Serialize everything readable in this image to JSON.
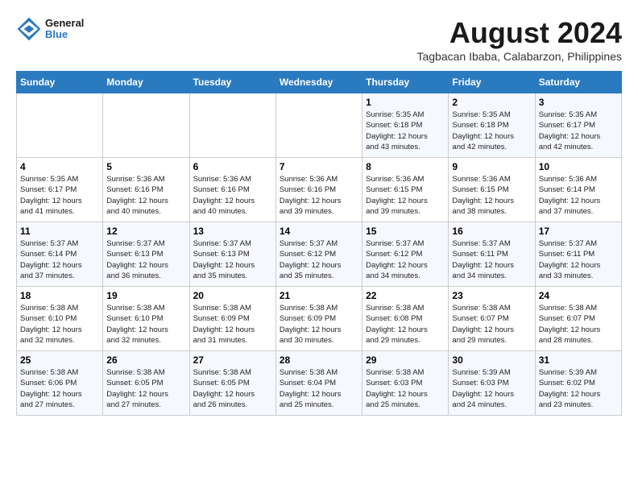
{
  "logo": {
    "line1": "General",
    "line2": "Blue"
  },
  "title": "August 2024",
  "subtitle": "Tagbacan Ibaba, Calabarzon, Philippines",
  "days_of_week": [
    "Sunday",
    "Monday",
    "Tuesday",
    "Wednesday",
    "Thursday",
    "Friday",
    "Saturday"
  ],
  "weeks": [
    [
      {
        "day": "",
        "info": ""
      },
      {
        "day": "",
        "info": ""
      },
      {
        "day": "",
        "info": ""
      },
      {
        "day": "",
        "info": ""
      },
      {
        "day": "1",
        "info": "Sunrise: 5:35 AM\nSunset: 6:18 PM\nDaylight: 12 hours\nand 43 minutes."
      },
      {
        "day": "2",
        "info": "Sunrise: 5:35 AM\nSunset: 6:18 PM\nDaylight: 12 hours\nand 42 minutes."
      },
      {
        "day": "3",
        "info": "Sunrise: 5:35 AM\nSunset: 6:17 PM\nDaylight: 12 hours\nand 42 minutes."
      }
    ],
    [
      {
        "day": "4",
        "info": "Sunrise: 5:35 AM\nSunset: 6:17 PM\nDaylight: 12 hours\nand 41 minutes."
      },
      {
        "day": "5",
        "info": "Sunrise: 5:36 AM\nSunset: 6:16 PM\nDaylight: 12 hours\nand 40 minutes."
      },
      {
        "day": "6",
        "info": "Sunrise: 5:36 AM\nSunset: 6:16 PM\nDaylight: 12 hours\nand 40 minutes."
      },
      {
        "day": "7",
        "info": "Sunrise: 5:36 AM\nSunset: 6:16 PM\nDaylight: 12 hours\nand 39 minutes."
      },
      {
        "day": "8",
        "info": "Sunrise: 5:36 AM\nSunset: 6:15 PM\nDaylight: 12 hours\nand 39 minutes."
      },
      {
        "day": "9",
        "info": "Sunrise: 5:36 AM\nSunset: 6:15 PM\nDaylight: 12 hours\nand 38 minutes."
      },
      {
        "day": "10",
        "info": "Sunrise: 5:36 AM\nSunset: 6:14 PM\nDaylight: 12 hours\nand 37 minutes."
      }
    ],
    [
      {
        "day": "11",
        "info": "Sunrise: 5:37 AM\nSunset: 6:14 PM\nDaylight: 12 hours\nand 37 minutes."
      },
      {
        "day": "12",
        "info": "Sunrise: 5:37 AM\nSunset: 6:13 PM\nDaylight: 12 hours\nand 36 minutes."
      },
      {
        "day": "13",
        "info": "Sunrise: 5:37 AM\nSunset: 6:13 PM\nDaylight: 12 hours\nand 35 minutes."
      },
      {
        "day": "14",
        "info": "Sunrise: 5:37 AM\nSunset: 6:12 PM\nDaylight: 12 hours\nand 35 minutes."
      },
      {
        "day": "15",
        "info": "Sunrise: 5:37 AM\nSunset: 6:12 PM\nDaylight: 12 hours\nand 34 minutes."
      },
      {
        "day": "16",
        "info": "Sunrise: 5:37 AM\nSunset: 6:11 PM\nDaylight: 12 hours\nand 34 minutes."
      },
      {
        "day": "17",
        "info": "Sunrise: 5:37 AM\nSunset: 6:11 PM\nDaylight: 12 hours\nand 33 minutes."
      }
    ],
    [
      {
        "day": "18",
        "info": "Sunrise: 5:38 AM\nSunset: 6:10 PM\nDaylight: 12 hours\nand 32 minutes."
      },
      {
        "day": "19",
        "info": "Sunrise: 5:38 AM\nSunset: 6:10 PM\nDaylight: 12 hours\nand 32 minutes."
      },
      {
        "day": "20",
        "info": "Sunrise: 5:38 AM\nSunset: 6:09 PM\nDaylight: 12 hours\nand 31 minutes."
      },
      {
        "day": "21",
        "info": "Sunrise: 5:38 AM\nSunset: 6:09 PM\nDaylight: 12 hours\nand 30 minutes."
      },
      {
        "day": "22",
        "info": "Sunrise: 5:38 AM\nSunset: 6:08 PM\nDaylight: 12 hours\nand 29 minutes."
      },
      {
        "day": "23",
        "info": "Sunrise: 5:38 AM\nSunset: 6:07 PM\nDaylight: 12 hours\nand 29 minutes."
      },
      {
        "day": "24",
        "info": "Sunrise: 5:38 AM\nSunset: 6:07 PM\nDaylight: 12 hours\nand 28 minutes."
      }
    ],
    [
      {
        "day": "25",
        "info": "Sunrise: 5:38 AM\nSunset: 6:06 PM\nDaylight: 12 hours\nand 27 minutes."
      },
      {
        "day": "26",
        "info": "Sunrise: 5:38 AM\nSunset: 6:05 PM\nDaylight: 12 hours\nand 27 minutes."
      },
      {
        "day": "27",
        "info": "Sunrise: 5:38 AM\nSunset: 6:05 PM\nDaylight: 12 hours\nand 26 minutes."
      },
      {
        "day": "28",
        "info": "Sunrise: 5:38 AM\nSunset: 6:04 PM\nDaylight: 12 hours\nand 25 minutes."
      },
      {
        "day": "29",
        "info": "Sunrise: 5:38 AM\nSunset: 6:03 PM\nDaylight: 12 hours\nand 25 minutes."
      },
      {
        "day": "30",
        "info": "Sunrise: 5:39 AM\nSunset: 6:03 PM\nDaylight: 12 hours\nand 24 minutes."
      },
      {
        "day": "31",
        "info": "Sunrise: 5:39 AM\nSunset: 6:02 PM\nDaylight: 12 hours\nand 23 minutes."
      }
    ]
  ]
}
